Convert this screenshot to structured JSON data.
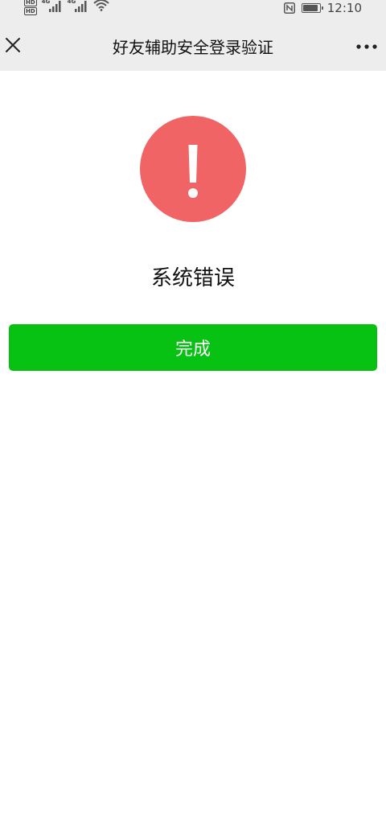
{
  "status_bar": {
    "hd_badges": [
      "HD",
      "HD"
    ],
    "signal_labels": [
      "4G",
      "4G"
    ],
    "time": "12:10",
    "battery_level": 0.9
  },
  "nav": {
    "title": "好友辅助安全登录验证",
    "close_icon": "close-icon",
    "more_icon": "more-dots-icon"
  },
  "content": {
    "icon": "warning-exclamation-icon",
    "message": "系统错误",
    "done_label": "完成"
  },
  "colors": {
    "warning": "#f06465",
    "primary_button": "#07c113",
    "header_bg": "#ededed"
  }
}
